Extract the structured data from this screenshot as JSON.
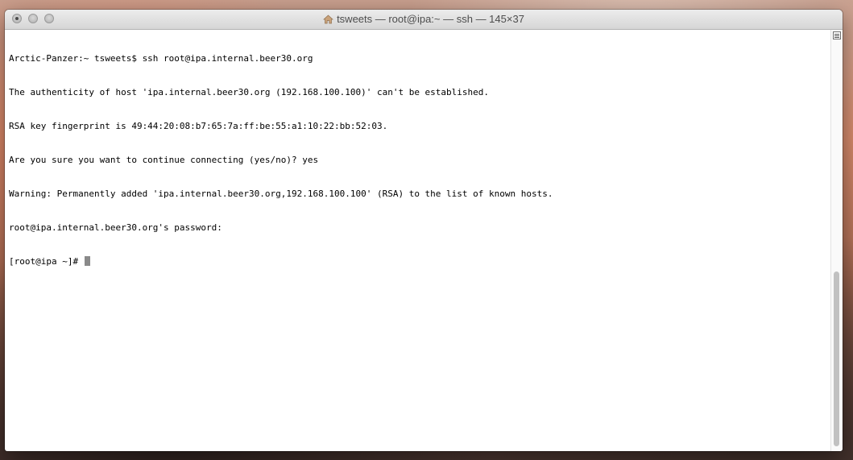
{
  "window": {
    "title": "tsweets — root@ipa:~ — ssh — 145×37"
  },
  "terminal": {
    "lines": [
      "Arctic-Panzer:~ tsweets$ ssh root@ipa.internal.beer30.org",
      "The authenticity of host 'ipa.internal.beer30.org (192.168.100.100)' can't be established.",
      "RSA key fingerprint is 49:44:20:08:b7:65:7a:ff:be:55:a1:10:22:bb:52:03.",
      "Are you sure you want to continue connecting (yes/no)? yes",
      "Warning: Permanently added 'ipa.internal.beer30.org,192.168.100.100' (RSA) to the list of known hosts.",
      "root@ipa.internal.beer30.org's password:",
      "[root@ipa ~]# "
    ]
  },
  "icons": {
    "title_icon": "home-icon",
    "scroll_menu": "list-menu-icon"
  },
  "colors": {
    "cursor": "#8a8a8a",
    "text": "#000000",
    "background": "#ffffff"
  }
}
